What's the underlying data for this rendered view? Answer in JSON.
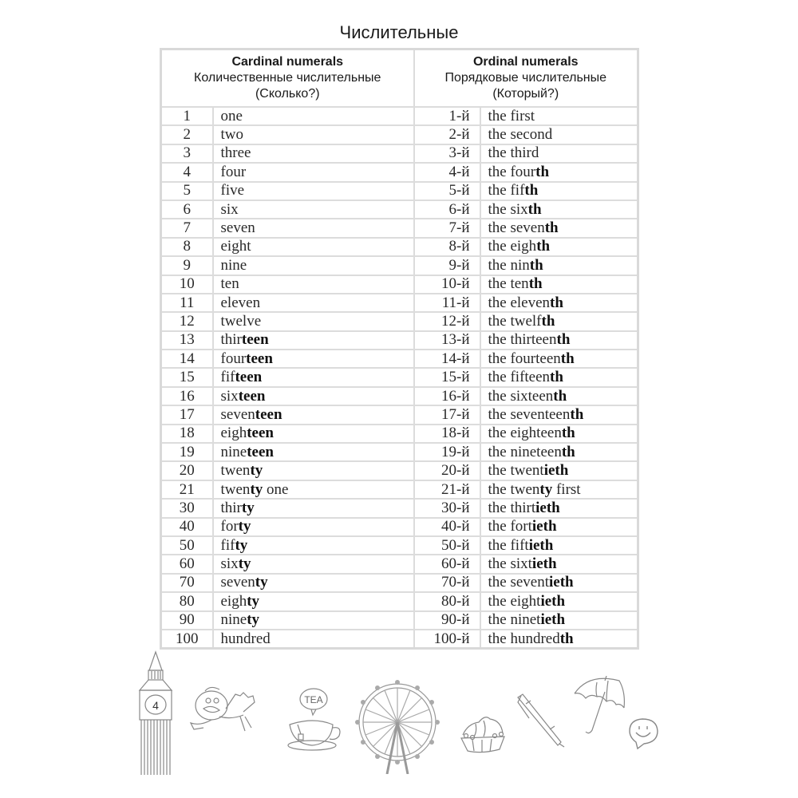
{
  "page": {
    "title": "Числительные"
  },
  "table": {
    "cardinal_header": {
      "title": "Cardinal numerals",
      "subtitle": "Количественные числительные",
      "question": "(Сколько?)"
    },
    "ordinal_header": {
      "title": "Ordinal numerals",
      "subtitle": "Порядковые числительные",
      "question": "(Который?)"
    },
    "rows": [
      {
        "num": "1",
        "word": [
          {
            "t": "one",
            "b": false
          }
        ],
        "ord_num": "1-й",
        "ordinal": [
          {
            "t": "the first",
            "b": false
          }
        ]
      },
      {
        "num": "2",
        "word": [
          {
            "t": "two",
            "b": false
          }
        ],
        "ord_num": "2-й",
        "ordinal": [
          {
            "t": "the second",
            "b": false
          }
        ]
      },
      {
        "num": "3",
        "word": [
          {
            "t": "three",
            "b": false
          }
        ],
        "ord_num": "3-й",
        "ordinal": [
          {
            "t": "the third",
            "b": false
          }
        ]
      },
      {
        "num": "4",
        "word": [
          {
            "t": "four",
            "b": false
          }
        ],
        "ord_num": "4-й",
        "ordinal": [
          {
            "t": "the four",
            "b": false
          },
          {
            "t": "th",
            "b": true
          }
        ]
      },
      {
        "num": "5",
        "word": [
          {
            "t": "five",
            "b": false
          }
        ],
        "ord_num": "5-й",
        "ordinal": [
          {
            "t": "the fif",
            "b": false
          },
          {
            "t": "th",
            "b": true
          }
        ]
      },
      {
        "num": "6",
        "word": [
          {
            "t": "six",
            "b": false
          }
        ],
        "ord_num": "6-й",
        "ordinal": [
          {
            "t": "the six",
            "b": false
          },
          {
            "t": "th",
            "b": true
          }
        ]
      },
      {
        "num": "7",
        "word": [
          {
            "t": "seven",
            "b": false
          }
        ],
        "ord_num": "7-й",
        "ordinal": [
          {
            "t": "the seven",
            "b": false
          },
          {
            "t": "th",
            "b": true
          }
        ]
      },
      {
        "num": "8",
        "word": [
          {
            "t": "eight",
            "b": false
          }
        ],
        "ord_num": "8-й",
        "ordinal": [
          {
            "t": "the eigh",
            "b": false
          },
          {
            "t": "th",
            "b": true
          }
        ]
      },
      {
        "num": "9",
        "word": [
          {
            "t": "nine",
            "b": false
          }
        ],
        "ord_num": "9-й",
        "ordinal": [
          {
            "t": "the nin",
            "b": false
          },
          {
            "t": "th",
            "b": true
          }
        ]
      },
      {
        "num": "10",
        "word": [
          {
            "t": "ten",
            "b": false
          }
        ],
        "ord_num": "10-й",
        "ordinal": [
          {
            "t": "the ten",
            "b": false
          },
          {
            "t": "th",
            "b": true
          }
        ]
      },
      {
        "num": "11",
        "word": [
          {
            "t": "eleven",
            "b": false
          }
        ],
        "ord_num": "11-й",
        "ordinal": [
          {
            "t": "the eleven",
            "b": false
          },
          {
            "t": "th",
            "b": true
          }
        ]
      },
      {
        "num": "12",
        "word": [
          {
            "t": "twelve",
            "b": false
          }
        ],
        "ord_num": "12-й",
        "ordinal": [
          {
            "t": "the twelf",
            "b": false
          },
          {
            "t": "th",
            "b": true
          }
        ]
      },
      {
        "num": "13",
        "word": [
          {
            "t": "thir",
            "b": false
          },
          {
            "t": "teen",
            "b": true
          }
        ],
        "ord_num": "13-й",
        "ordinal": [
          {
            "t": "the thirteen",
            "b": false
          },
          {
            "t": "th",
            "b": true
          }
        ]
      },
      {
        "num": "14",
        "word": [
          {
            "t": "four",
            "b": false
          },
          {
            "t": "teen",
            "b": true
          }
        ],
        "ord_num": "14-й",
        "ordinal": [
          {
            "t": "the fourteen",
            "b": false
          },
          {
            "t": "th",
            "b": true
          }
        ]
      },
      {
        "num": "15",
        "word": [
          {
            "t": "fif",
            "b": false
          },
          {
            "t": "teen",
            "b": true
          }
        ],
        "ord_num": "15-й",
        "ordinal": [
          {
            "t": "the fifteen",
            "b": false
          },
          {
            "t": "th",
            "b": true
          }
        ]
      },
      {
        "num": "16",
        "word": [
          {
            "t": "six",
            "b": false
          },
          {
            "t": "teen",
            "b": true
          }
        ],
        "ord_num": "16-й",
        "ordinal": [
          {
            "t": "the sixteen",
            "b": false
          },
          {
            "t": "th",
            "b": true
          }
        ]
      },
      {
        "num": "17",
        "word": [
          {
            "t": "seven",
            "b": false
          },
          {
            "t": "teen",
            "b": true
          }
        ],
        "ord_num": "17-й",
        "ordinal": [
          {
            "t": "the seventeen",
            "b": false
          },
          {
            "t": "th",
            "b": true
          }
        ]
      },
      {
        "num": "18",
        "word": [
          {
            "t": "eigh",
            "b": false
          },
          {
            "t": "teen",
            "b": true
          }
        ],
        "ord_num": "18-й",
        "ordinal": [
          {
            "t": "the eighteen",
            "b": false
          },
          {
            "t": "th",
            "b": true
          }
        ]
      },
      {
        "num": "19",
        "word": [
          {
            "t": "nine",
            "b": false
          },
          {
            "t": "teen",
            "b": true
          }
        ],
        "ord_num": "19-й",
        "ordinal": [
          {
            "t": "the nineteen",
            "b": false
          },
          {
            "t": "th",
            "b": true
          }
        ]
      },
      {
        "num": "20",
        "word": [
          {
            "t": "twen",
            "b": false
          },
          {
            "t": "ty",
            "b": true
          }
        ],
        "ord_num": "20-й",
        "ordinal": [
          {
            "t": "the twent",
            "b": false
          },
          {
            "t": "ieth",
            "b": true
          }
        ]
      },
      {
        "num": "21",
        "word": [
          {
            "t": "twen",
            "b": false
          },
          {
            "t": "ty",
            "b": true
          },
          {
            "t": " one",
            "b": false
          }
        ],
        "ord_num": "21-й",
        "ordinal": [
          {
            "t": "the twen",
            "b": false
          },
          {
            "t": "ty",
            "b": true
          },
          {
            "t": " first",
            "b": false
          }
        ]
      },
      {
        "num": "30",
        "word": [
          {
            "t": "thir",
            "b": false
          },
          {
            "t": "ty",
            "b": true
          }
        ],
        "ord_num": "30-й",
        "ordinal": [
          {
            "t": "the thirt",
            "b": false
          },
          {
            "t": "ieth",
            "b": true
          }
        ]
      },
      {
        "num": "40",
        "word": [
          {
            "t": "for",
            "b": false
          },
          {
            "t": "ty",
            "b": true
          }
        ],
        "ord_num": "40-й",
        "ordinal": [
          {
            "t": "the fort",
            "b": false
          },
          {
            "t": "ieth",
            "b": true
          }
        ]
      },
      {
        "num": "50",
        "word": [
          {
            "t": "fif",
            "b": false
          },
          {
            "t": "ty",
            "b": true
          }
        ],
        "ord_num": "50-й",
        "ordinal": [
          {
            "t": "the fift",
            "b": false
          },
          {
            "t": "ieth",
            "b": true
          }
        ]
      },
      {
        "num": "60",
        "word": [
          {
            "t": "six",
            "b": false
          },
          {
            "t": "ty",
            "b": true
          }
        ],
        "ord_num": "60-й",
        "ordinal": [
          {
            "t": "the sixt",
            "b": false
          },
          {
            "t": "ieth",
            "b": true
          }
        ]
      },
      {
        "num": "70",
        "word": [
          {
            "t": "seven",
            "b": false
          },
          {
            "t": "ty",
            "b": true
          }
        ],
        "ord_num": "70-й",
        "ordinal": [
          {
            "t": "the sevent",
            "b": false
          },
          {
            "t": "ieth",
            "b": true
          }
        ]
      },
      {
        "num": "80",
        "word": [
          {
            "t": "eigh",
            "b": false
          },
          {
            "t": "ty",
            "b": true
          }
        ],
        "ord_num": "80-й",
        "ordinal": [
          {
            "t": "the eight",
            "b": false
          },
          {
            "t": "ieth",
            "b": true
          }
        ]
      },
      {
        "num": "90",
        "word": [
          {
            "t": "nine",
            "b": false
          },
          {
            "t": "ty",
            "b": true
          }
        ],
        "ord_num": "90-й",
        "ordinal": [
          {
            "t": "the ninet",
            "b": false
          },
          {
            "t": "ieth",
            "b": true
          }
        ]
      },
      {
        "num": "100",
        "word": [
          {
            "t": "hundred",
            "b": false
          }
        ],
        "ord_num": "100-й",
        "ordinal": [
          {
            "t": "the hundred",
            "b": false
          },
          {
            "t": "th",
            "b": true
          }
        ]
      }
    ]
  },
  "illustrations": {
    "clock_tower_digit": "4",
    "tea_bubble_text": "TEA",
    "items": [
      "big-ben",
      "bird",
      "teacup",
      "ferris-wheel",
      "cupcake",
      "pen",
      "umbrella",
      "smiley-bubble"
    ]
  },
  "colors": {
    "border": "#dcdcdc",
    "text": "#1a1a1a",
    "sketch": "#808080"
  }
}
